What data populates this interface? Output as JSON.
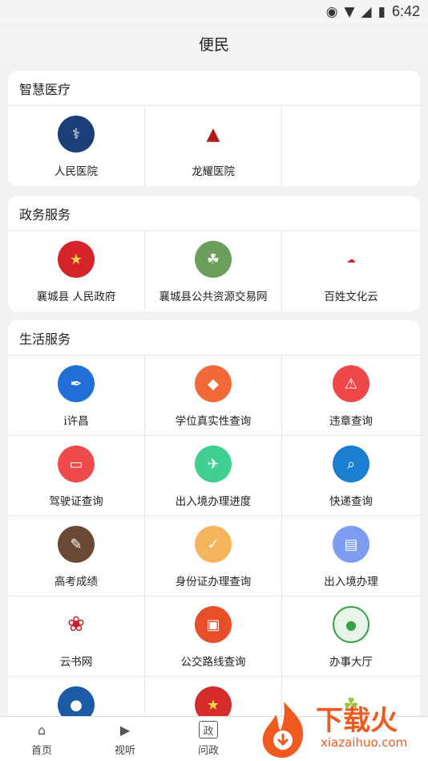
{
  "status_bar": {
    "time": "6:42",
    "icons": [
      "location-icon",
      "wifi-icon",
      "signal-icon",
      "battery-icon"
    ]
  },
  "header": {
    "title": "便民"
  },
  "sections": [
    {
      "title": "智慧医疗",
      "items": [
        {
          "label": "人民医院",
          "icon": "hospital-emblem-icon",
          "color": "#1c3f7a"
        },
        {
          "label": "龙耀医院",
          "icon": "longyao-logo-icon",
          "color": "#b31b1b"
        },
        {
          "label": "",
          "icon": "",
          "color": ""
        }
      ]
    },
    {
      "title": "政务服务",
      "items": [
        {
          "label": "襄城县 人民政府",
          "icon": "national-emblem-icon",
          "color": "#d4242a"
        },
        {
          "label": "襄城县公共资源交易网",
          "icon": "leaf-photo-icon",
          "color": "#6b9e5a"
        },
        {
          "label": "百姓文化云",
          "icon": "baixing-wenhua-logo-icon",
          "color": "#c8202b"
        }
      ]
    },
    {
      "title": "生活服务",
      "items": [
        {
          "label": "i许昌",
          "icon": "ixuchang-icon",
          "color": "#1f6fd6"
        },
        {
          "label": "学位真实性查询",
          "icon": "graduation-cap-icon",
          "color": "#f26a3a"
        },
        {
          "label": "违章查询",
          "icon": "violation-icon",
          "color": "#f04848"
        },
        {
          "label": "驾驶证查询",
          "icon": "driver-license-icon",
          "color": "#ef4b4b"
        },
        {
          "label": "出入境办理进度",
          "icon": "airplane-icon",
          "color": "#3fcf8e"
        },
        {
          "label": "快递查询",
          "icon": "express-search-icon",
          "color": "#1a7fd1"
        },
        {
          "label": "高考成绩",
          "icon": "exam-score-icon",
          "color": "#6b4a35"
        },
        {
          "label": "身份证办理查询",
          "icon": "id-card-icon",
          "color": "#f6b55c"
        },
        {
          "label": "出入境办理",
          "icon": "passport-icon",
          "color": "#7b9cf0"
        },
        {
          "label": "云书网",
          "icon": "yunshu-logo-icon",
          "color": "#c8202b"
        },
        {
          "label": "公交路线查询",
          "icon": "bus-icon",
          "color": "#e94e2b"
        },
        {
          "label": "办事大厅",
          "icon": "bianmin-bubble-icon",
          "color": "#3aa04a"
        },
        {
          "label": "",
          "icon": "partial-blue-logo-icon",
          "color": "#1c5aa6"
        },
        {
          "label": "",
          "icon": "partial-red-logo-icon",
          "color": "#d62b2b"
        },
        {
          "label": "",
          "icon": "partial-green-logo-icon",
          "color": "#9ac43c"
        }
      ]
    }
  ],
  "tab_bar": [
    {
      "label": "首页",
      "icon": "home-icon"
    },
    {
      "label": "视听",
      "icon": "tv-icon"
    },
    {
      "label": "问政",
      "icon": "zheng-icon",
      "glyph": "政"
    }
  ],
  "watermark": {
    "text": "下载火",
    "url": "xiazaihuo.com"
  }
}
